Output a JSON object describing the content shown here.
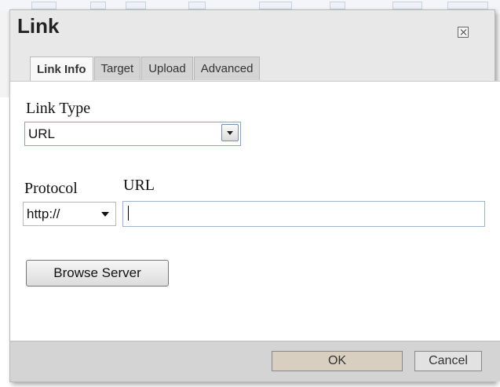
{
  "dialog": {
    "title": "Link",
    "close_icon": "close-icon"
  },
  "tabs": [
    {
      "label": "Link Info",
      "active": true
    },
    {
      "label": "Target",
      "active": false
    },
    {
      "label": "Upload",
      "active": false
    },
    {
      "label": "Advanced",
      "active": false
    }
  ],
  "form": {
    "link_type_label": "Link Type",
    "link_type_value": "URL",
    "protocol_label": "Protocol",
    "protocol_value": "http://",
    "url_label": "URL",
    "url_value": "",
    "browse_server_label": "Browse Server"
  },
  "footer": {
    "ok_label": "OK",
    "cancel_label": "Cancel"
  },
  "colors": {
    "dialog_bg": "#e8e8e8",
    "footer_bg": "#d4d4d4",
    "field_border": "#9cb3d1"
  }
}
